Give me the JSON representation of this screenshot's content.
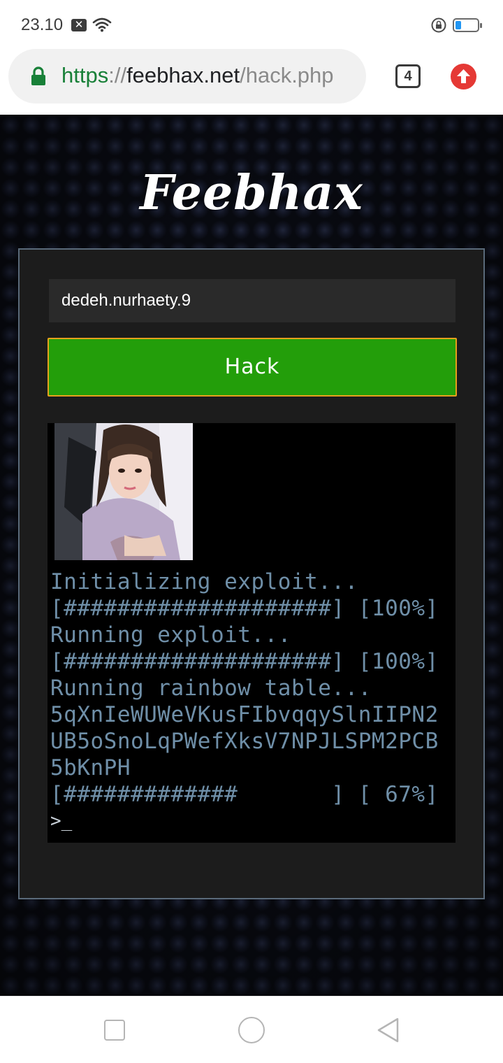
{
  "status_bar": {
    "time": "23.10",
    "notification_badge": "✕"
  },
  "browser": {
    "url_scheme": "https",
    "url_sep": "://",
    "url_host": "feebhax.net",
    "url_path": "/hack.php",
    "tab_count": "4"
  },
  "page": {
    "logo": "Feebhax",
    "username_value": "dedeh.nurhaety.9",
    "hack_button": "Hack",
    "terminal": {
      "lines": [
        "Initializing exploit...",
        "[####################] [100%]",
        "Running exploit...",
        "[####################] [100%]",
        "Running rainbow table...",
        "5qXnIeWUWeVKusFIbvqqySlnIIPN2",
        "UB5oSnoLqPWefXksV7NPJLSPM2PCB",
        "5bKnPH",
        "[#############       ] [ 67%]"
      ],
      "prompt": ">_"
    }
  },
  "colors": {
    "accent_green": "#239e0a",
    "button_border": "#e6a01c",
    "terminal_text": "#6f8fa8",
    "url_green": "#188038"
  },
  "icons": [
    "x-notification-icon",
    "wifi-icon",
    "lock-rotation-icon",
    "battery-icon",
    "secure-lock-icon",
    "tabs-icon",
    "upload-arrow-icon",
    "nav-recents-icon",
    "nav-home-icon",
    "nav-back-icon"
  ]
}
